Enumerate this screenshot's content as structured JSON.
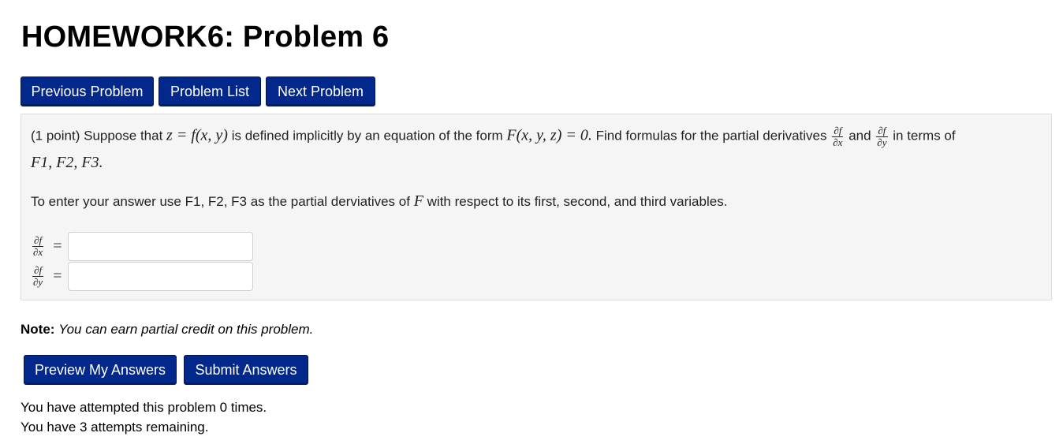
{
  "header": {
    "title": "HOMEWORK6: Problem 6"
  },
  "nav": {
    "previous_label": "Previous Problem",
    "list_label": "Problem List",
    "next_label": "Next Problem"
  },
  "problem": {
    "points": "(1 point)",
    "text_suppose": "Suppose that",
    "math_z_eq": "z = f(x, y)",
    "text_defined": "is defined implicitly by an equation of the form",
    "math_F_eq": "F(x, y, z) = 0.",
    "text_find": "Find formulas for the partial derivatives",
    "frac_num": "∂f",
    "frac_den_x": "∂x",
    "frac_den_y": "∂y",
    "text_and": "and",
    "text_terms": "in terms of",
    "math_F_list": "F1, F2, F3.",
    "instruction_prefix": "To enter your answer use F1, F2, F3 as the partial derviatives of",
    "instruction_var": "F",
    "instruction_suffix": "with respect to its first, second, and third variables.",
    "answers": [
      {
        "num": "∂f",
        "den": "∂x",
        "equals": "=",
        "value": ""
      },
      {
        "num": "∂f",
        "den": "∂y",
        "equals": "=",
        "value": ""
      }
    ]
  },
  "note": {
    "label": "Note:",
    "text": "You can earn partial credit on this problem."
  },
  "actions": {
    "preview_label": "Preview My Answers",
    "submit_label": "Submit Answers"
  },
  "status": {
    "attempted": "You have attempted this problem 0 times.",
    "remaining": "You have 3 attempts remaining."
  }
}
